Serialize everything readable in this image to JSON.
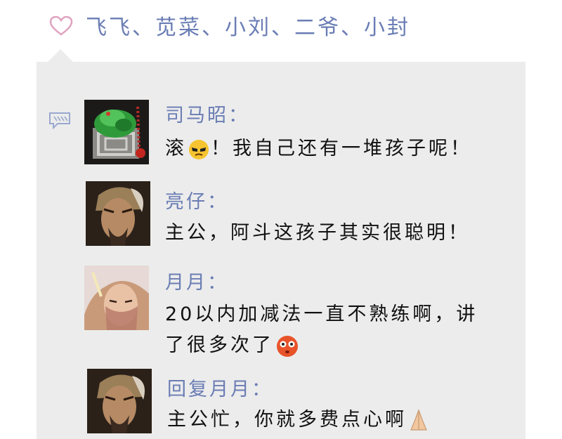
{
  "likes": {
    "icon": "heart-outline-icon",
    "text": "飞飞、苋菜、小刘、二爷、小封",
    "color": "#6a7db4"
  },
  "comments_section": {
    "comment_icon": "comment-bubble-icon",
    "items": [
      {
        "author": "司马昭：",
        "text_before": "滚",
        "emoji": "sunglasses-grumpy-emoji",
        "text_after": "！我自己还有一堆孩子呢！",
        "avatar": "green-dragon-avatar"
      },
      {
        "author": "亮仔：",
        "text": "主公，阿斗这孩子其实很聪明！",
        "avatar": "bearded-strategist-avatar"
      },
      {
        "author": "月月：",
        "text_line1": "20以内加减法一直不熟练啊，讲",
        "text_line2": "了很多次了",
        "emoji": "flushed-face-emoji",
        "avatar": "veiled-woman-avatar"
      },
      {
        "author": "回复月月：",
        "text": "主公忙，你就多费点心啊",
        "emoji": "folded-hands-emoji",
        "avatar": "bearded-strategist-avatar"
      }
    ]
  }
}
